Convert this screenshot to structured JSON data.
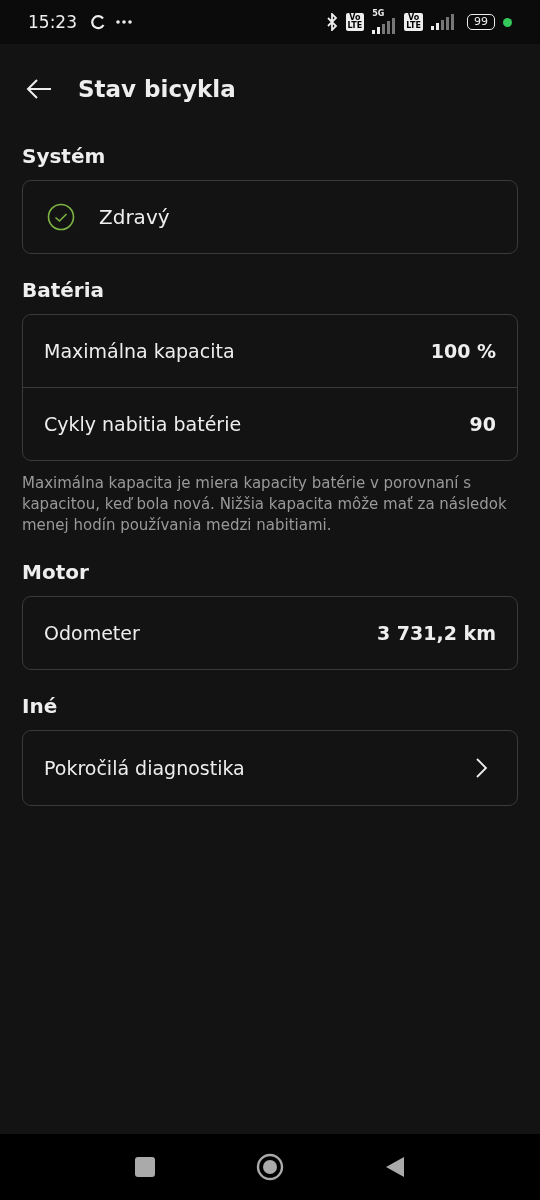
{
  "status_bar": {
    "time": "15:23",
    "sims": [
      {
        "badge_top": "Vo",
        "badge_bottom": "LTE",
        "network": "5G"
      },
      {
        "badge_top": "Vo",
        "badge_bottom": "LTE"
      }
    ],
    "battery": "99"
  },
  "header": {
    "title": "Stav bicykla"
  },
  "sections": [
    {
      "title": "Systém",
      "kind": "status",
      "status": "Zdravý"
    },
    {
      "title": "Batéria",
      "kind": "rows",
      "rows": [
        {
          "label": "Maximálna kapacita",
          "value": "100 %"
        },
        {
          "label": "Cykly nabitia batérie",
          "value": "90"
        }
      ],
      "note": "Maximálna kapacita je miera kapacity batérie v porovnaní s kapacitou, keď bola nová. Nižšia kapacita môže mať za následok menej hodín používania medzi nabitiami."
    },
    {
      "title": "Motor",
      "kind": "rows",
      "rows": [
        {
          "label": "Odometer",
          "value": "3 731,2 km"
        }
      ]
    },
    {
      "title": "Iné",
      "kind": "link",
      "label": "Pokročilá diagnostika"
    }
  ]
}
